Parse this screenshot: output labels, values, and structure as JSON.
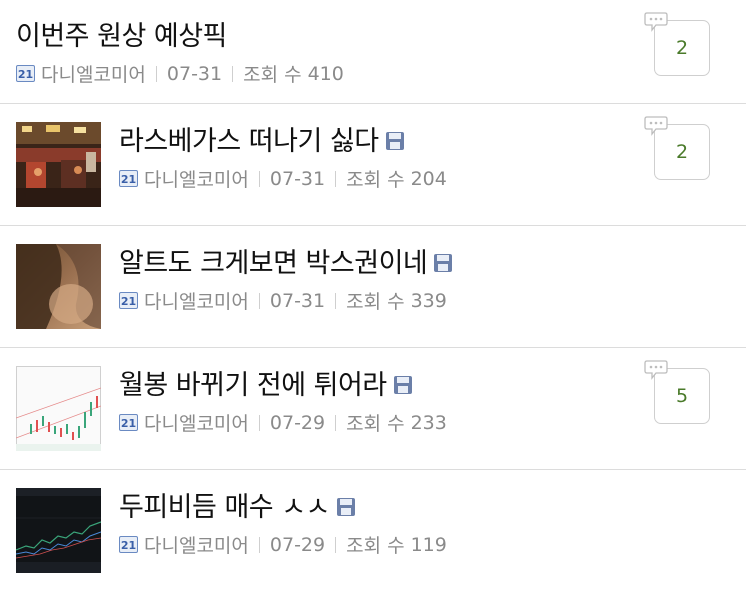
{
  "posts": [
    {
      "title": "이번주 원상 예상픽",
      "author": "다니엘코미어",
      "date": "07-31",
      "views_label": "조회 수",
      "views": "410",
      "comments": "2",
      "has_image_icon": false,
      "level_icon_text": "21",
      "thumbnail": "none"
    },
    {
      "title": "라스베가스 떠나기 싫다",
      "author": "다니엘코미어",
      "date": "07-31",
      "views_label": "조회 수",
      "views": "204",
      "comments": "2",
      "has_image_icon": true,
      "level_icon_text": "21",
      "thumbnail": "casino"
    },
    {
      "title": "알트도 크게보면 박스권이네",
      "author": "다니엘코미어",
      "date": "07-31",
      "views_label": "조회 수",
      "views": "339",
      "comments": "",
      "has_image_icon": true,
      "level_icon_text": "21",
      "thumbnail": "hair"
    },
    {
      "title": "월봉 바뀌기 전에 튀어라",
      "author": "다니엘코미어",
      "date": "07-29",
      "views_label": "조회 수",
      "views": "233",
      "comments": "5",
      "has_image_icon": true,
      "level_icon_text": "21",
      "thumbnail": "chart-light"
    },
    {
      "title": "두피비듬 매수 ㅅㅅ",
      "author": "다니엘코미어",
      "date": "07-29",
      "views_label": "조회 수",
      "views": "119",
      "comments": "",
      "has_image_icon": true,
      "level_icon_text": "21",
      "thumbnail": "chart-dark"
    }
  ],
  "colors": {
    "comment_count": "#4a7a2a",
    "meta_text": "#8a8a8a",
    "divider": "#dcdcdc",
    "title_text": "#111111"
  }
}
